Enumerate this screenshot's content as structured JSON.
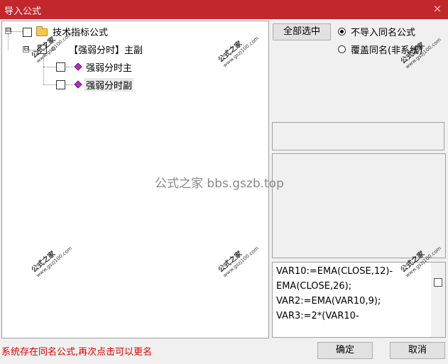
{
  "window": {
    "title": "导入公式",
    "close_icon": "×"
  },
  "tree": {
    "root": {
      "label": "技术指标公式",
      "expander": "⊟"
    },
    "group": {
      "label": "【强弱分时】主副",
      "expander": "⊟"
    },
    "items": [
      {
        "label": "强弱分时主"
      },
      {
        "label": "强弱分时副"
      }
    ]
  },
  "select_all_label": "全部选中",
  "options": [
    {
      "label": "不导入同名公式",
      "selected": true
    },
    {
      "label": "覆盖同名(非系统)",
      "selected": false
    }
  ],
  "formula_lines": [
    "VAR10:=EMA(CLOSE,12)-",
    "EMA(CLOSE,26);",
    "VAR2:=EMA(VAR10,9);",
    "VAR3:=2*(VAR10-"
  ],
  "status_text": "系统存在同名公式,再次点击可以更名",
  "ok_label": "确定",
  "cancel_label": "取消",
  "watermark_center": "公式之家 bbs.gszb.top",
  "watermark_stamp": {
    "title": "公式之家",
    "url": "www.gszj100.com"
  },
  "colors": {
    "titlebar": "#c1272d",
    "status": "#e00000",
    "diamond": "#b030c0"
  }
}
